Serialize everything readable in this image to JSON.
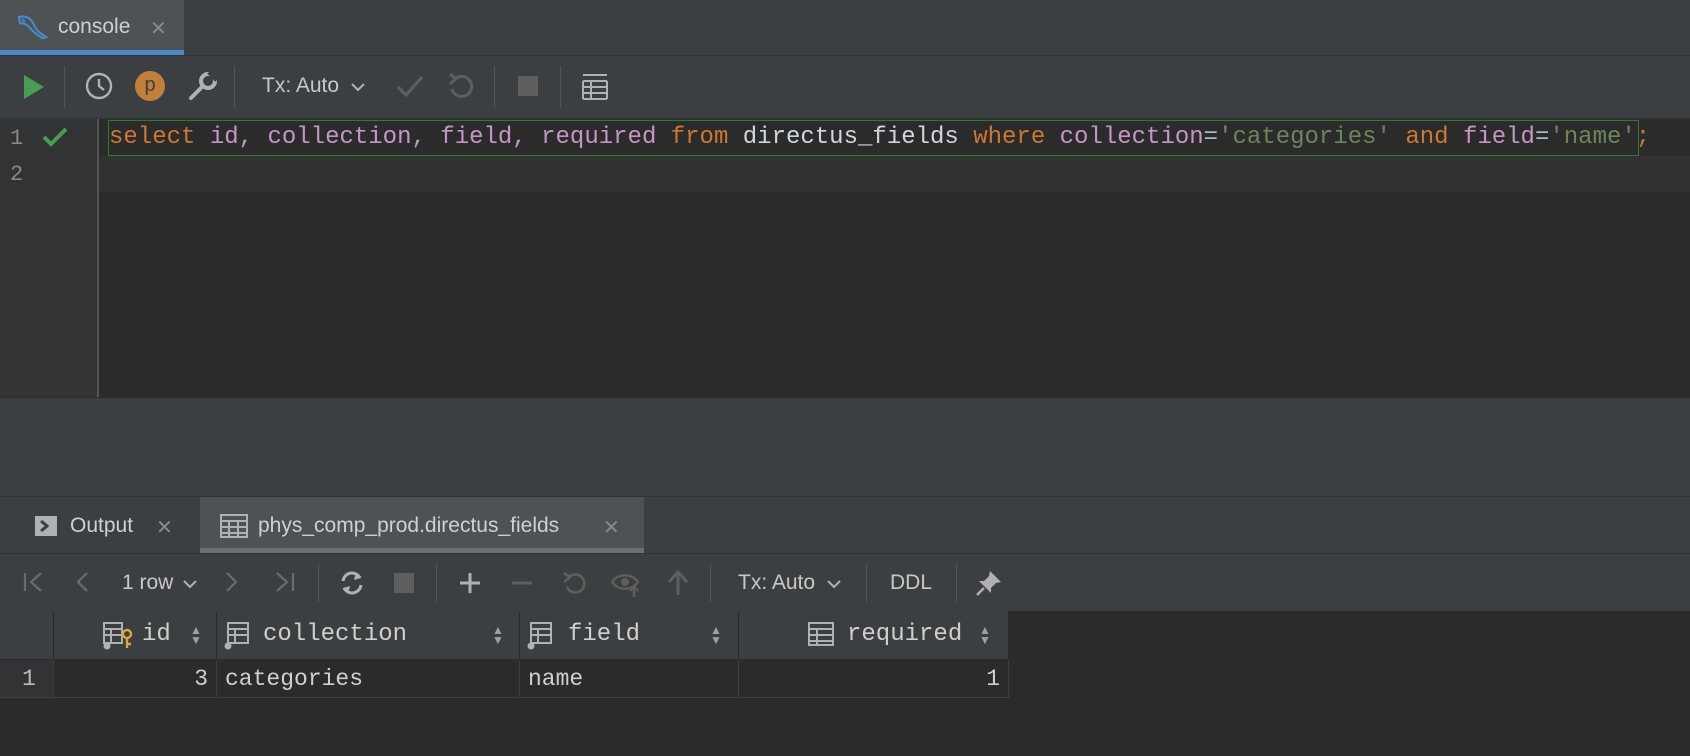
{
  "window": {
    "tab_label": "console",
    "tab_close": "✕"
  },
  "toolbar": {
    "tx_label": "Tx: Auto",
    "profile_badge": "p",
    "icons": [
      "run-icon",
      "history-icon",
      "profile-icon",
      "wrench-icon",
      "chevron-down-icon",
      "commit-icon",
      "rollback-icon",
      "stop-icon",
      "table-view-icon"
    ]
  },
  "editor": {
    "line_numbers": [
      "1",
      "2"
    ],
    "sql_tokens": [
      {
        "t": "select",
        "c": "kw"
      },
      {
        "t": " ",
        "c": "pl"
      },
      {
        "t": "id,",
        "c": "id"
      },
      {
        "t": " ",
        "c": "pl"
      },
      {
        "t": "collection,",
        "c": "id"
      },
      {
        "t": " ",
        "c": "pl"
      },
      {
        "t": "field,",
        "c": "id"
      },
      {
        "t": " ",
        "c": "pl"
      },
      {
        "t": "required",
        "c": "id"
      },
      {
        "t": " ",
        "c": "pl"
      },
      {
        "t": "from",
        "c": "kw"
      },
      {
        "t": " ",
        "c": "pl"
      },
      {
        "t": "directus_fields",
        "c": "tbl"
      },
      {
        "t": " ",
        "c": "pl"
      },
      {
        "t": "where",
        "c": "kw"
      },
      {
        "t": " ",
        "c": "pl"
      },
      {
        "t": "collection",
        "c": "id"
      },
      {
        "t": "=",
        "c": "pl"
      },
      {
        "t": "'categories'",
        "c": "str"
      },
      {
        "t": " ",
        "c": "pl"
      },
      {
        "t": "and",
        "c": "kw"
      },
      {
        "t": " ",
        "c": "pl"
      },
      {
        "t": "field",
        "c": "id"
      },
      {
        "t": "=",
        "c": "pl"
      },
      {
        "t": "'name'",
        "c": "str"
      },
      {
        "t": ";",
        "c": "kw"
      }
    ],
    "status_color": "#499c54"
  },
  "results": {
    "tabs": [
      {
        "label": "Output",
        "close": "✕"
      },
      {
        "label": "phys_comp_prod.directus_fields",
        "close": "✕"
      }
    ],
    "row_count_label": "1 row",
    "tx_label": "Tx: Auto",
    "ddl_label": "DDL",
    "columns": [
      "id",
      "collection",
      "field",
      "required"
    ],
    "rows": [
      {
        "num": "1",
        "cells": [
          "3",
          "categories",
          "name",
          "1"
        ]
      }
    ]
  },
  "colors": {
    "accent": "#4a88c7",
    "run_green": "#499c54",
    "profile_orange": "#c17f3a"
  }
}
